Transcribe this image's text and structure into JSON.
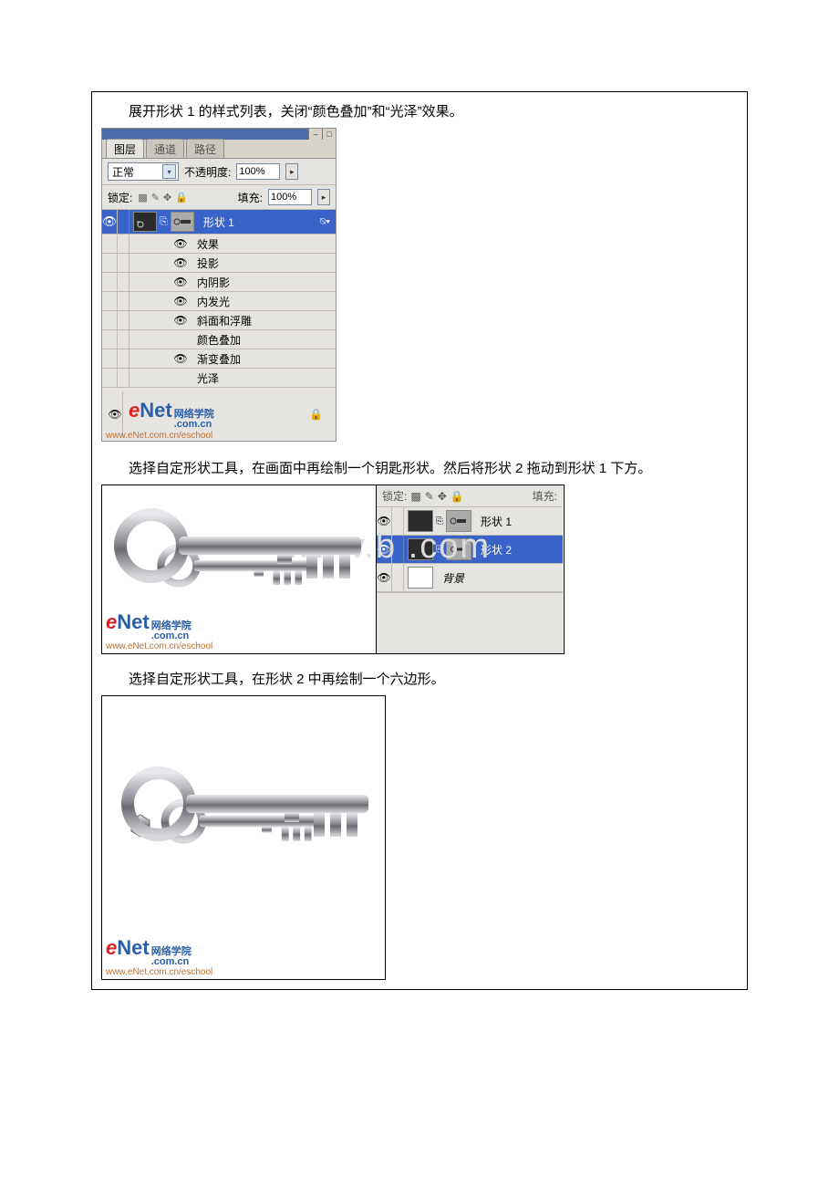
{
  "instructions": {
    "line1": "展开形状 1 的样式列表，关闭“颜色叠加”和“光泽”效果。",
    "line2": "选择自定形状工具，在画面中再绘制一个钥匙形状。然后将形状 2 拖动到形状 1 下方。",
    "line3": "选择自定形状工具，在形状 2 中再绘制一个六边形。"
  },
  "panel": {
    "tabs": {
      "layers": "图层",
      "channels": "通道",
      "paths": "路径"
    },
    "blend_label": "正常",
    "opacity_label": "不透明度:",
    "opacity_value": "100%",
    "lock_label": "锁定:",
    "fill_label": "填充:",
    "fill_value": "100%",
    "shape1": "形状 1",
    "effects_label": "效果",
    "effects": {
      "drop_shadow": "投影",
      "inner_shadow": "内阴影",
      "inner_glow": "内发光",
      "bevel": "斜面和浮雕",
      "color_overlay": "颜色叠加",
      "gradient_overlay": "渐变叠加",
      "satin": "光泽"
    }
  },
  "mini": {
    "lock_label": "锁定:",
    "fill_label": "填充:",
    "shape1": "形状 1",
    "shape2": "形状 2",
    "background": "背景"
  },
  "logo": {
    "e": "e",
    "net": "Net",
    "sub1": "网络学院",
    "sub2": ".com.cn",
    "eschool": "www.eNet.com.cn/eschool"
  },
  "watermark": "www.b          .com"
}
